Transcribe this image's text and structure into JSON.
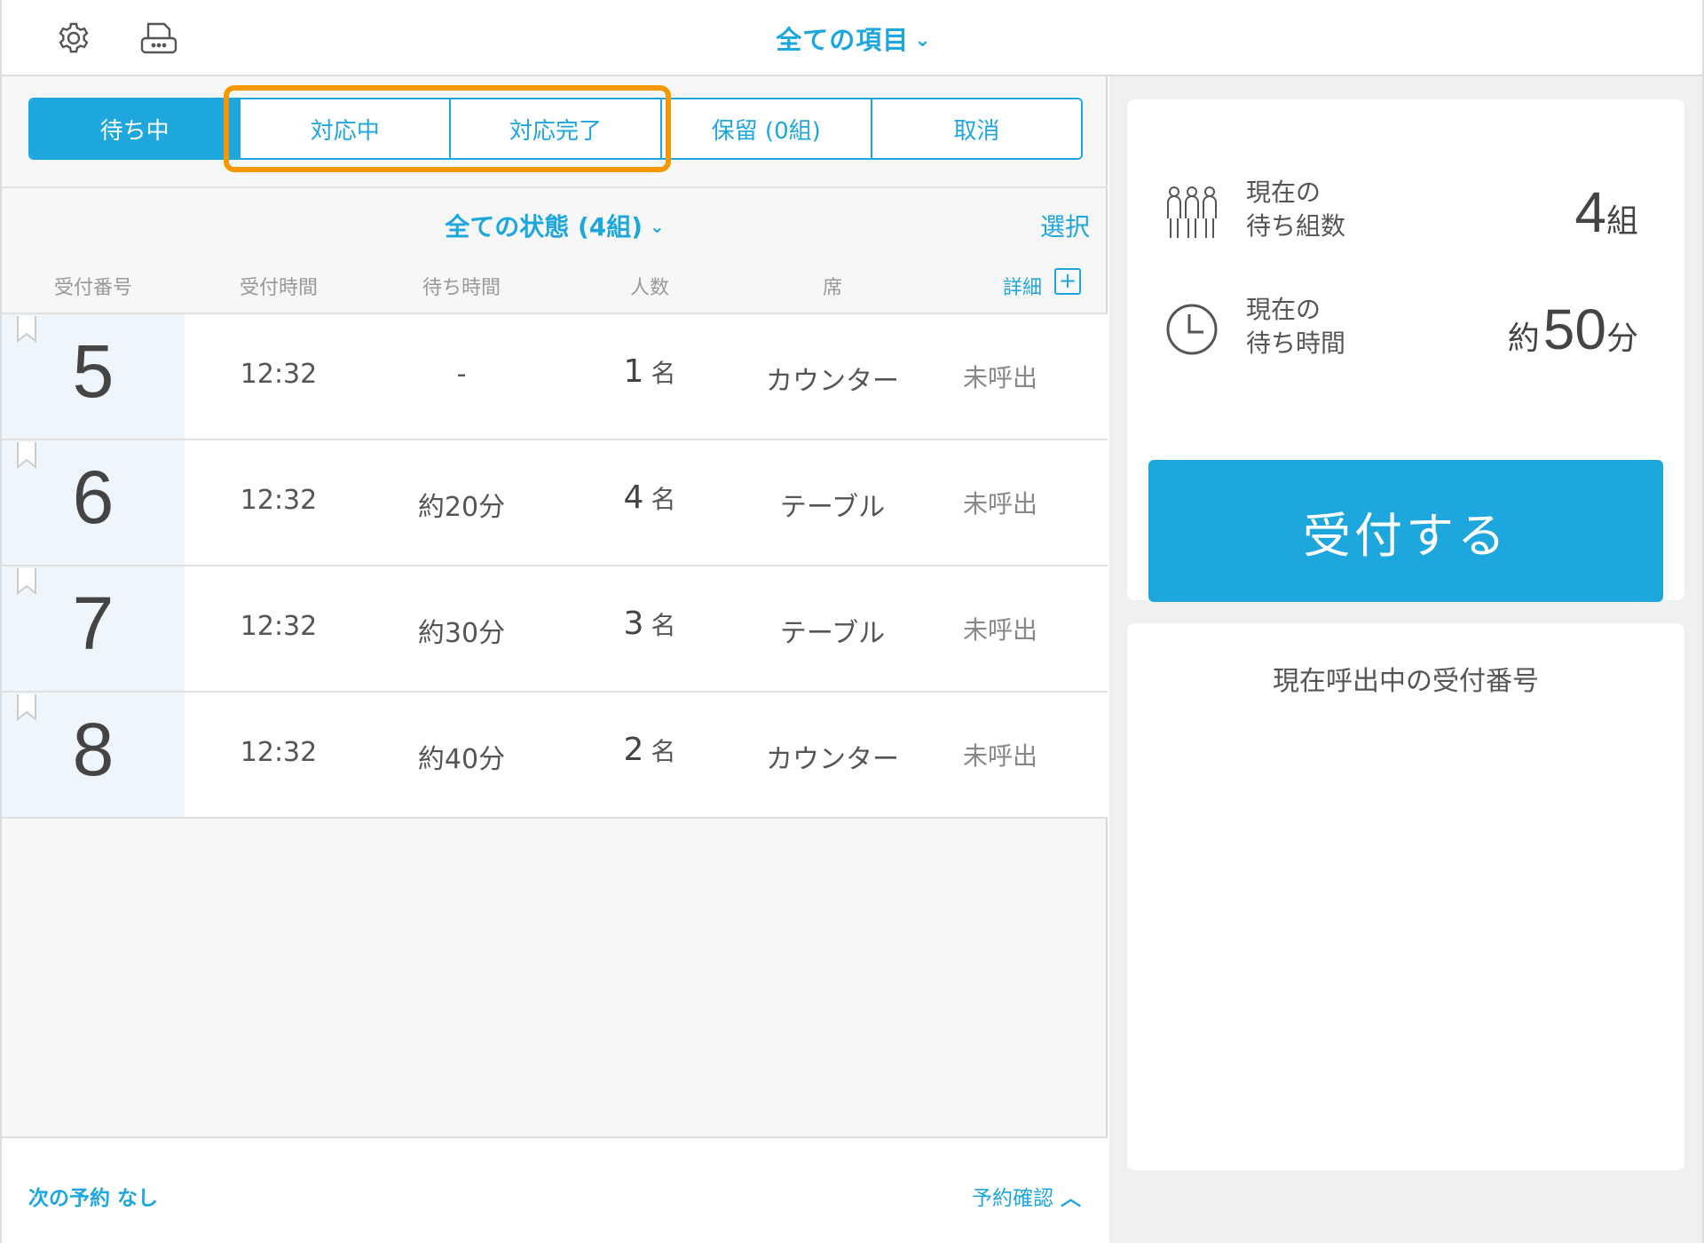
{
  "header": {
    "title": "全ての項目",
    "settings_icon": "gear-icon",
    "printer_icon": "printer-icon"
  },
  "tabs": [
    {
      "label": "待ち中",
      "active": true
    },
    {
      "label": "対応中",
      "active": false
    },
    {
      "label": "対応完了",
      "active": false
    },
    {
      "label": "保留 (0組)",
      "active": false
    },
    {
      "label": "取消",
      "active": false
    }
  ],
  "filter": {
    "label": "全ての状態 (4組)",
    "select_label": "選択"
  },
  "columns": {
    "number": "受付番号",
    "time": "受付時間",
    "wait": "待ち時間",
    "people": "人数",
    "seat": "席",
    "detail": "詳細",
    "detail_plus": "+"
  },
  "rows": [
    {
      "number": "5",
      "time": "12:32",
      "wait": "-",
      "people": "1",
      "people_unit": "名",
      "seat": "カウンター",
      "status": "未呼出"
    },
    {
      "number": "6",
      "time": "12:32",
      "wait": "約20分",
      "people": "4",
      "people_unit": "名",
      "seat": "テーブル",
      "status": "未呼出"
    },
    {
      "number": "7",
      "time": "12:32",
      "wait": "約30分",
      "people": "3",
      "people_unit": "名",
      "seat": "テーブル",
      "status": "未呼出"
    },
    {
      "number": "8",
      "time": "12:32",
      "wait": "約40分",
      "people": "2",
      "people_unit": "名",
      "seat": "カウンター",
      "status": "未呼出"
    }
  ],
  "footer": {
    "next_reservation": "次の予約 なし",
    "reservation_confirm": "予約確認"
  },
  "stats": {
    "groups_label_1": "現在の",
    "groups_label_2": "待ち組数",
    "groups_value": "4",
    "groups_unit": "組",
    "wait_label_1": "現在の",
    "wait_label_2": "待ち時間",
    "wait_prefix": "約",
    "wait_value": "50",
    "wait_unit": "分"
  },
  "reception_button": "受付する",
  "calling": {
    "title": "現在呼出中の受付番号"
  },
  "colors": {
    "accent": "#1ea7dd",
    "highlight": "#f39800"
  }
}
